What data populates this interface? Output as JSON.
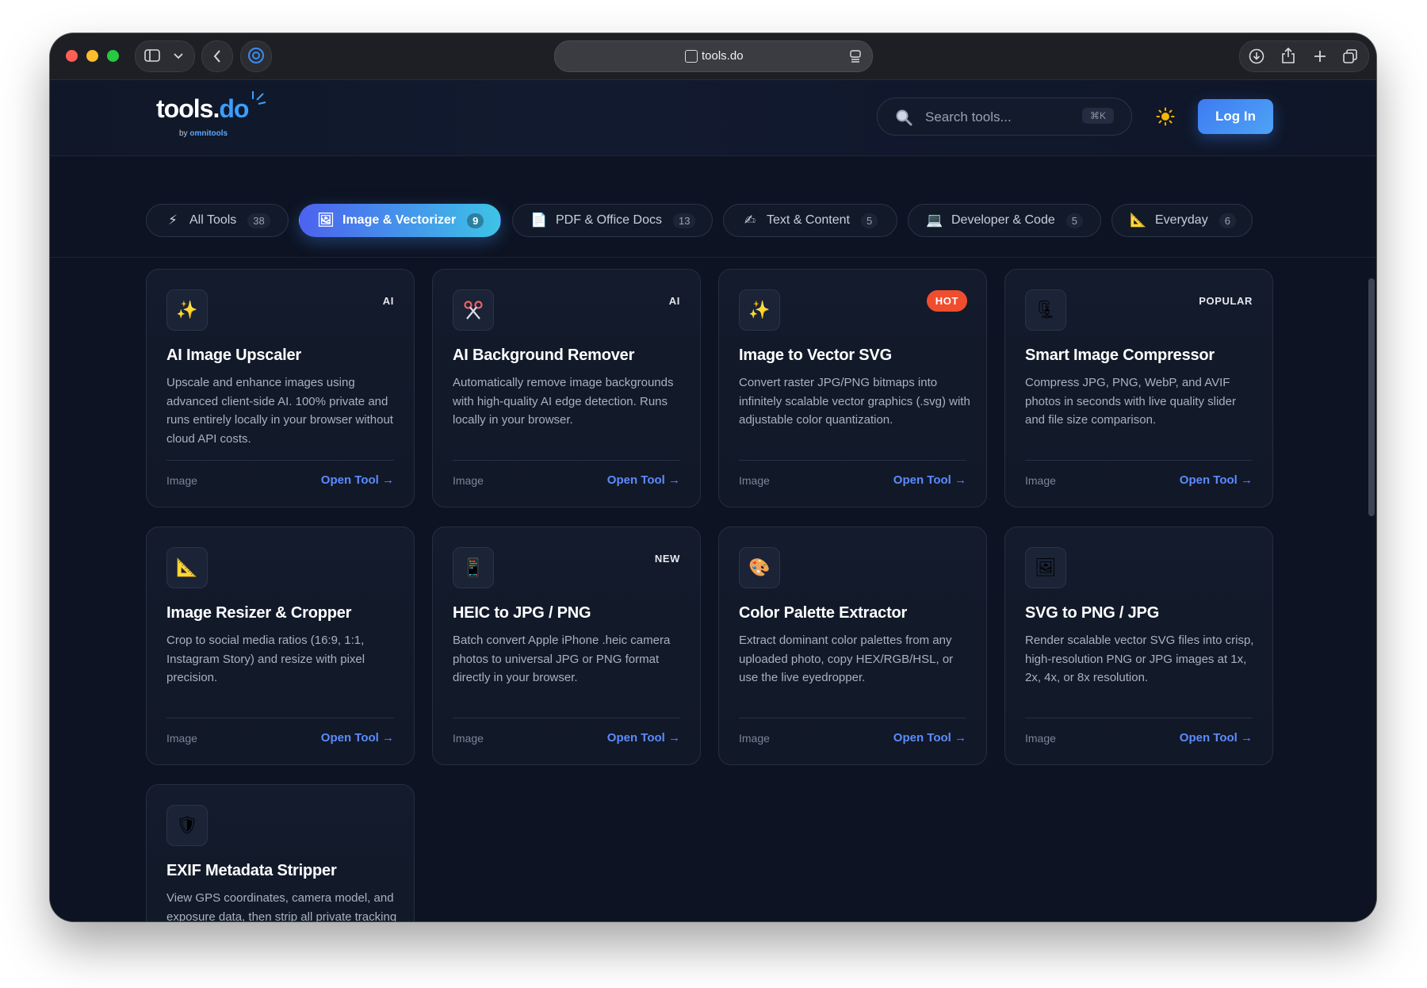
{
  "browser": {
    "url": "tools.do"
  },
  "header": {
    "logo_main": "tools.",
    "logo_accent": "do",
    "logo_sub_prefix": "by ",
    "logo_sub_brand": "omnitools",
    "search_placeholder": "Search tools...",
    "search_shortcut": "⌘K",
    "login_label": "Log In"
  },
  "tabs": [
    {
      "label": "All Tools",
      "count": "38",
      "icon": "⚡"
    },
    {
      "label": "Image & Vectorizer",
      "count": "9",
      "icon": "🖼"
    },
    {
      "label": "PDF & Office Docs",
      "count": "13",
      "icon": "📄"
    },
    {
      "label": "Text & Content",
      "count": "5",
      "icon": "✍"
    },
    {
      "label": "Developer & Code",
      "count": "5",
      "icon": "💻"
    },
    {
      "label": "Everyday",
      "count": "6",
      "icon": "📐"
    }
  ],
  "cards": [
    {
      "icon": "✨",
      "badge": "AI",
      "title": "AI Image Upscaler",
      "desc": "Upscale and enhance images using advanced client-side AI. 100% private and runs entirely locally in your browser without cloud API costs.",
      "category": "Image",
      "open": "Open Tool →"
    },
    {
      "icon": "✂",
      "badge": "AI",
      "title": "AI Background Remover",
      "desc": "Automatically remove image backgrounds with high-quality AI edge detection. Runs locally in your browser.",
      "category": "Image",
      "open": "Open Tool →"
    },
    {
      "icon": "✨",
      "badge": "HOT",
      "title": "Image to Vector SVG",
      "desc": "Convert raster JPG/PNG bitmaps into infinitely scalable vector graphics (.svg) with adjustable color quantization.",
      "category": "Image",
      "open": "Open Tool →"
    },
    {
      "icon": "🗜",
      "badge": "POPULAR",
      "title": "Smart Image Compressor",
      "desc": "Compress JPG, PNG, WebP, and AVIF photos in seconds with live quality slider and file size comparison.",
      "category": "Image",
      "open": "Open Tool →"
    },
    {
      "icon": "📐",
      "badge": "",
      "title": "Image Resizer & Cropper",
      "desc": "Crop to social media ratios (16:9, 1:1, Instagram Story) and resize with pixel precision.",
      "category": "Image",
      "open": "Open Tool →"
    },
    {
      "icon": "📱",
      "badge": "NEW",
      "title": "HEIC to JPG / PNG",
      "desc": "Batch convert Apple iPhone .heic camera photos to universal JPG or PNG format directly in your browser.",
      "category": "Image",
      "open": "Open Tool →"
    },
    {
      "icon": "🎨",
      "badge": "",
      "title": "Color Palette Extractor",
      "desc": "Extract dominant color palettes from any uploaded photo, copy HEX/RGB/HSL, or use the live eyedropper.",
      "category": "Image",
      "open": "Open Tool →"
    },
    {
      "icon": "🖼",
      "badge": "",
      "title": "SVG to PNG / JPG",
      "desc": "Render scalable vector SVG files into crisp, high-resolution PNG or JPG images at 1x, 2x, 4x, or 8x resolution.",
      "category": "Image",
      "open": "Open Tool →"
    },
    {
      "icon": "🛡",
      "badge": "",
      "title": "EXIF Metadata Stripper",
      "desc": "View GPS coordinates, camera model, and exposure data, then strip all private tracking metadata before sharing.",
      "category": "",
      "open": ""
    }
  ]
}
